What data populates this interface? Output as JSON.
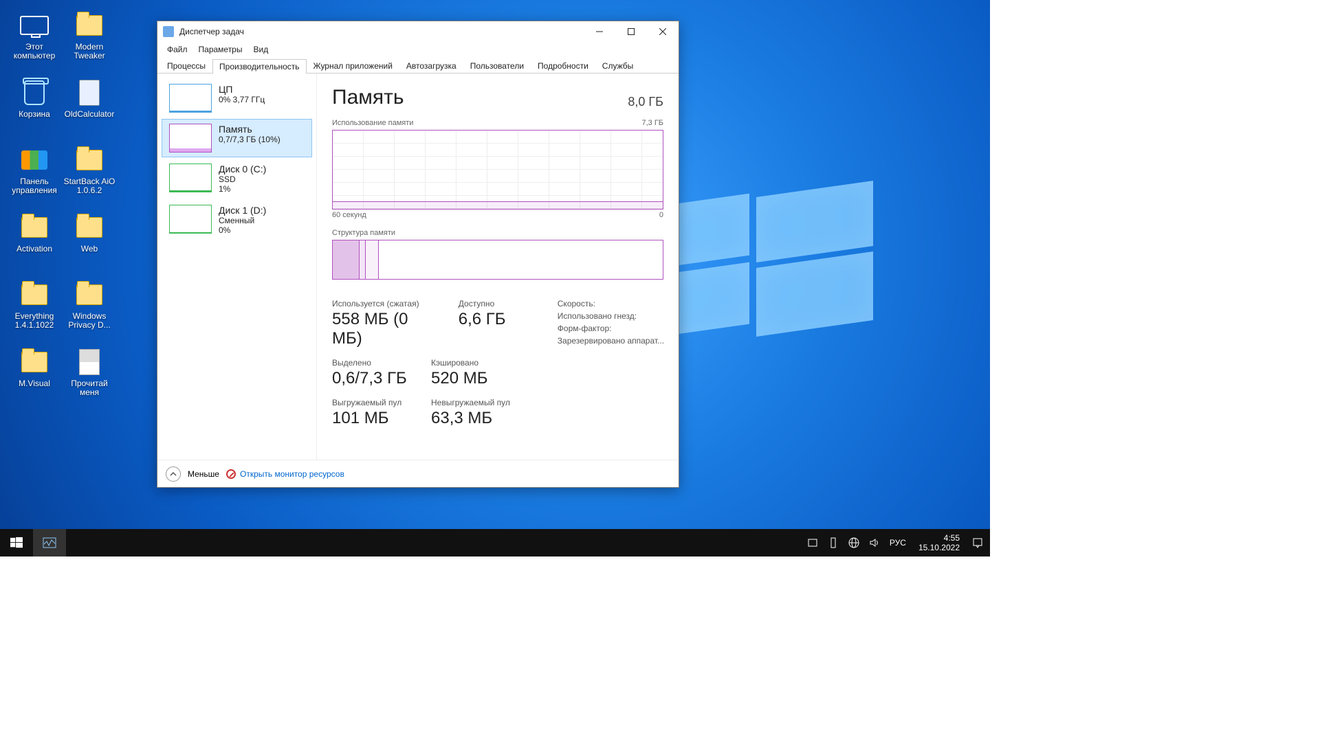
{
  "desktop_icons": [
    {
      "name": "this-pc",
      "label": "Этот\nкомпьютер",
      "icon": "pc"
    },
    {
      "name": "modern-tweaker",
      "label": "Modern\nTweaker",
      "icon": "folder"
    },
    {
      "name": "recycle-bin",
      "label": "Корзина",
      "icon": "bin"
    },
    {
      "name": "old-calculator",
      "label": "OldCalculator",
      "icon": "calc"
    },
    {
      "name": "control-panel",
      "label": "Панель\nуправления",
      "icon": "cp"
    },
    {
      "name": "startback",
      "label": "StartBack AiO\n1.0.6.2",
      "icon": "folder"
    },
    {
      "name": "activation",
      "label": "Activation",
      "icon": "folder"
    },
    {
      "name": "web",
      "label": "Web",
      "icon": "folder"
    },
    {
      "name": "everything",
      "label": "Everything\n1.4.1.1022",
      "icon": "folder"
    },
    {
      "name": "win-privacy",
      "label": "Windows\nPrivacy D...",
      "icon": "folder"
    },
    {
      "name": "mvisual",
      "label": "M.Visual",
      "icon": "folder"
    },
    {
      "name": "readme",
      "label": "Прочитай\nменя",
      "icon": "doc"
    }
  ],
  "window": {
    "title": "Диспетчер задач",
    "menu": [
      "Файл",
      "Параметры",
      "Вид"
    ],
    "tabs": [
      "Процессы",
      "Производительность",
      "Журнал приложений",
      "Автозагрузка",
      "Пользователи",
      "Подробности",
      "Службы"
    ],
    "active_tab": 1,
    "side": [
      {
        "key": "cpu",
        "title": "ЦП",
        "sub": "0%  3,77 ГГц"
      },
      {
        "key": "mem",
        "title": "Память",
        "sub": "0,7/7,3 ГБ (10%)"
      },
      {
        "key": "d0",
        "title": "Диск 0 (C:)",
        "sub": "SSD\n1%"
      },
      {
        "key": "d1",
        "title": "Диск 1 (D:)",
        "sub": "Сменный\n0%"
      }
    ],
    "side_selected": 1,
    "main": {
      "title": "Память",
      "capacity": "8,0 ГБ",
      "usage_label": "Использование памяти",
      "usage_max": "7,3 ГБ",
      "axis_left": "60 секунд",
      "axis_right": "0",
      "composition_label": "Структура памяти"
    },
    "stats": {
      "used_label": "Используется (сжатая)",
      "used": "558 МБ (0 МБ)",
      "avail_label": "Доступно",
      "avail": "6,6 ГБ",
      "commit_label": "Выделено",
      "commit": "0,6/7,3 ГБ",
      "cached_label": "Кэшировано",
      "cached": "520 МБ",
      "paged_label": "Выгружаемый пул",
      "paged": "101 МБ",
      "nonpaged_label": "Невыгружаемый пул",
      "nonpaged": "63,3 МБ"
    },
    "right": {
      "speed": "Скорость:",
      "slots": "Использовано гнезд:",
      "form": "Форм-фактор:",
      "hw": "Зарезервировано аппарат..."
    },
    "footer": {
      "less": "Меньше",
      "resmon": "Открыть монитор ресурсов"
    }
  },
  "taskbar": {
    "lang": "РУС",
    "time": "4:55",
    "date": "15.10.2022"
  }
}
